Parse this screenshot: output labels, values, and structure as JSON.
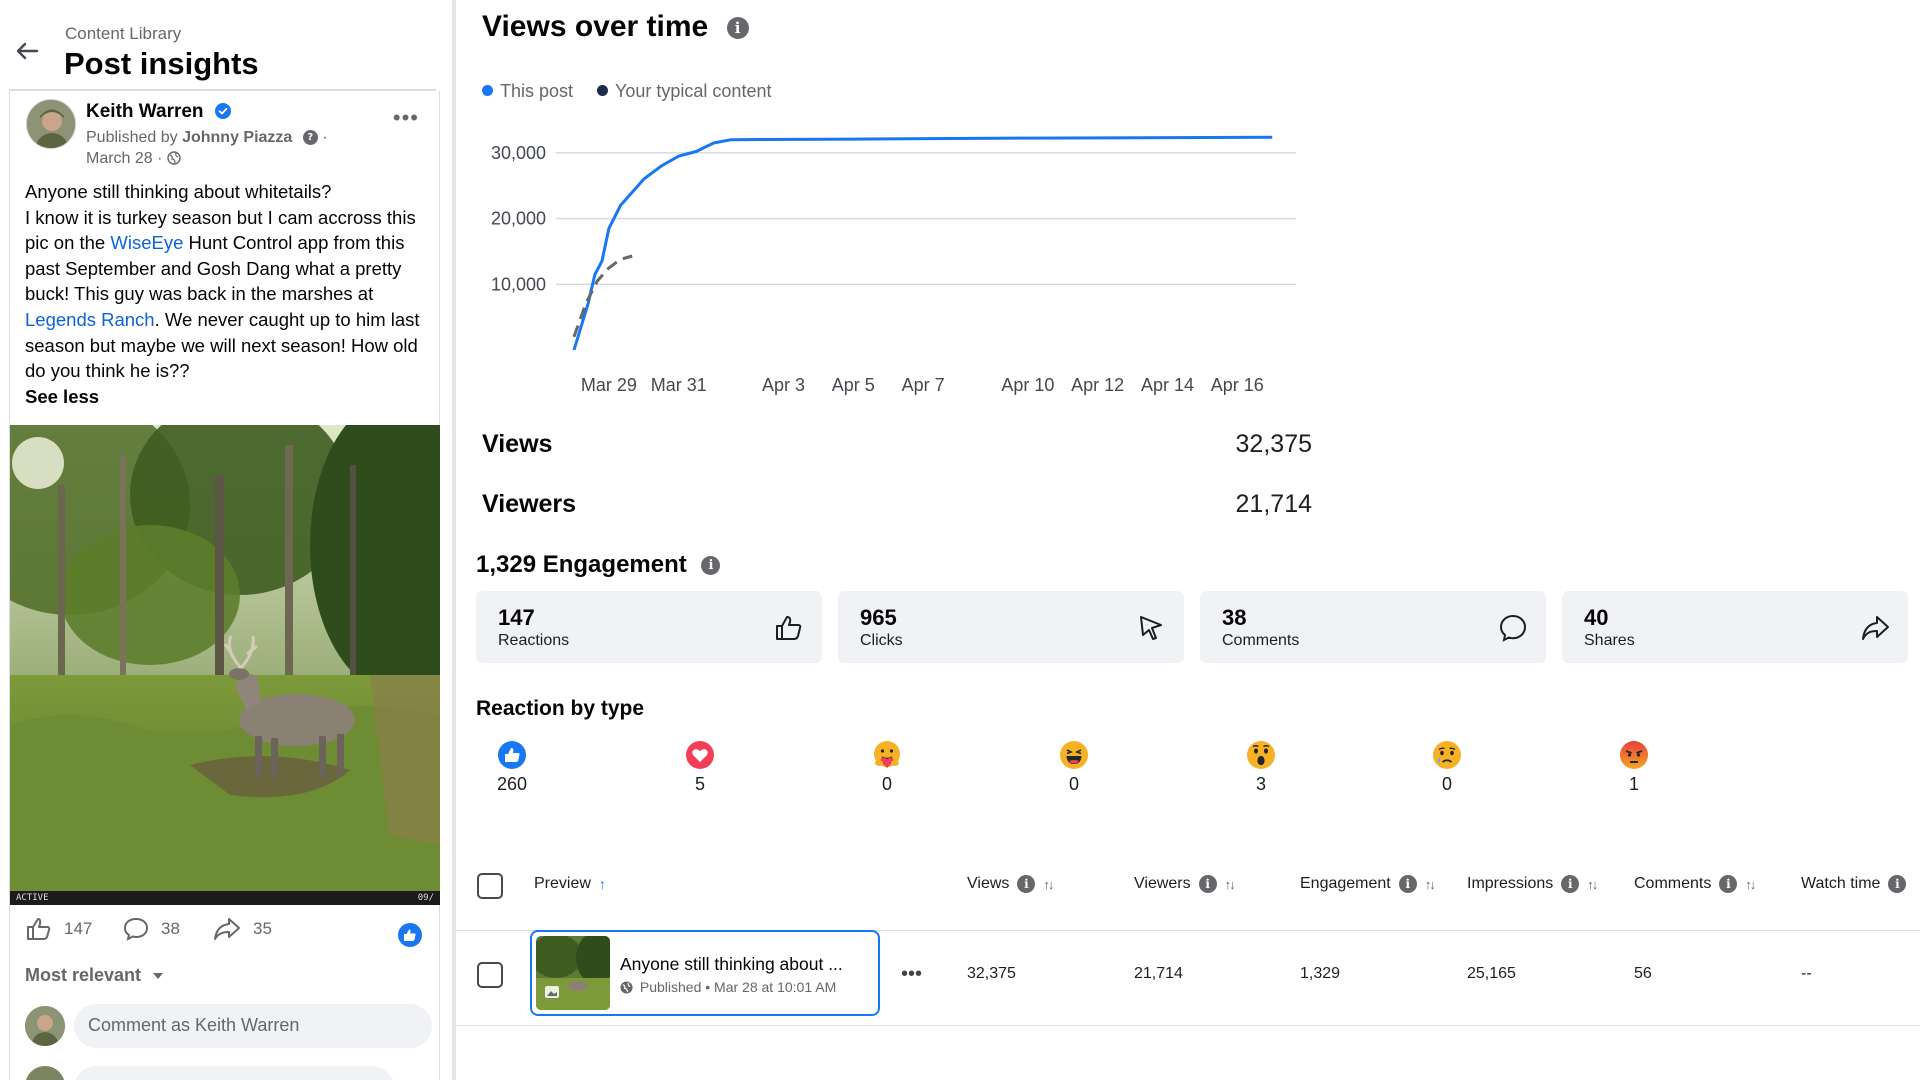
{
  "header": {
    "breadcrumb": "Content Library",
    "title": "Post insights"
  },
  "post": {
    "author": "Keith Warren",
    "published_prefix": "Published by",
    "publisher": "Johnny Piazza",
    "date": "March 28",
    "text_1": "Anyone still thinking about whitetails?",
    "text_2": "I know it is turkey season but I cam accross this pic on the ",
    "link_1": "WiseEye",
    "text_3": " Hunt Control app from this past September and Gosh Dang what a pretty buck! This guy was back in the marshes at ",
    "link_2": "Legends Ranch",
    "text_4": ". We never caught up to him last season but maybe we will next season! How old do you think he is??",
    "see_less": "See less",
    "photo_status_left": "ACTIVE",
    "photo_status_right": "09/",
    "likes": "147",
    "comments": "38",
    "shares": "35",
    "sort_label": "Most relevant",
    "comment_placeholder": "Comment as Keith Warren"
  },
  "views_over_time": {
    "title": "Views over time",
    "legend": {
      "this_post": "This post",
      "typical": "Your typical content"
    }
  },
  "chart_data": {
    "type": "line",
    "x_tick_labels": [
      "Mar 29",
      "Mar 31",
      "Apr 3",
      "Apr 5",
      "Apr 7",
      "Apr 10",
      "Apr 12",
      "Apr 14",
      "Apr 16"
    ],
    "y_tick_labels": [
      "10,000",
      "20,000",
      "30,000"
    ],
    "ylim": [
      0,
      35000
    ],
    "grid": true,
    "legend_position": "top-left",
    "series": [
      {
        "name": "This post",
        "color": "#1877f2",
        "points": [
          [
            "Mar 28",
            0
          ],
          [
            "Mar 28",
            3500
          ],
          [
            "Mar 28",
            7000
          ],
          [
            "Mar 28",
            11500
          ],
          [
            "Mar 28",
            13500
          ],
          [
            "Mar 29",
            18500
          ],
          [
            "Mar 29",
            22000
          ],
          [
            "Mar 29",
            24000
          ],
          [
            "Mar 30",
            26000
          ],
          [
            "Mar 30",
            28000
          ],
          [
            "Mar 31",
            29500
          ],
          [
            "Mar 31",
            30200
          ],
          [
            "Apr 1",
            31500
          ],
          [
            "Apr 1",
            32000
          ],
          [
            "Apr 5",
            32100
          ],
          [
            "Apr 10",
            32250
          ],
          [
            "Apr 17",
            32375
          ]
        ]
      },
      {
        "name": "Your typical content",
        "color": "#65676b",
        "style": "dashed",
        "points": [
          [
            "Mar 28",
            2000
          ],
          [
            "Mar 28",
            7000
          ],
          [
            "Mar 28",
            10500
          ],
          [
            "Mar 29",
            12500
          ],
          [
            "Mar 29",
            13800
          ],
          [
            "Mar 29",
            14300
          ]
        ]
      }
    ]
  },
  "metrics": {
    "views_label": "Views",
    "views_value": "32,375",
    "viewers_label": "Viewers",
    "viewers_value": "21,714"
  },
  "engagement": {
    "title": "1,329 Engagement",
    "cards": [
      {
        "value": "147",
        "label": "Reactions",
        "icon": "thumbs-up-icon"
      },
      {
        "value": "965",
        "label": "Clicks",
        "icon": "cursor-icon"
      },
      {
        "value": "38",
        "label": "Comments",
        "icon": "comment-icon"
      },
      {
        "value": "40",
        "label": "Shares",
        "icon": "share-icon"
      }
    ]
  },
  "reactions": {
    "title": "Reaction by type",
    "items": [
      {
        "type": "like",
        "count": "260",
        "color": "#1877f2"
      },
      {
        "type": "love",
        "count": "5",
        "color": "#f33e58"
      },
      {
        "type": "care",
        "count": "0",
        "color": "#f7b125"
      },
      {
        "type": "haha",
        "count": "0",
        "color": "#f7b125"
      },
      {
        "type": "wow",
        "count": "3",
        "color": "#f7b125"
      },
      {
        "type": "sad",
        "count": "0",
        "color": "#f7b125"
      },
      {
        "type": "angry",
        "count": "1",
        "color": "#e9710f"
      }
    ]
  },
  "table": {
    "headers": {
      "preview": "Preview",
      "views": "Views",
      "viewers": "Viewers",
      "engagement": "Engagement",
      "impressions": "Impressions",
      "comments": "Comments",
      "watch_time": "Watch time"
    },
    "row": {
      "title": "Anyone still thinking about ...",
      "meta": "Published • Mar 28 at 10:01 AM",
      "views": "32,375",
      "viewers": "21,714",
      "engagement": "1,329",
      "impressions": "25,165",
      "comments": "56",
      "watch_time": "--"
    }
  }
}
